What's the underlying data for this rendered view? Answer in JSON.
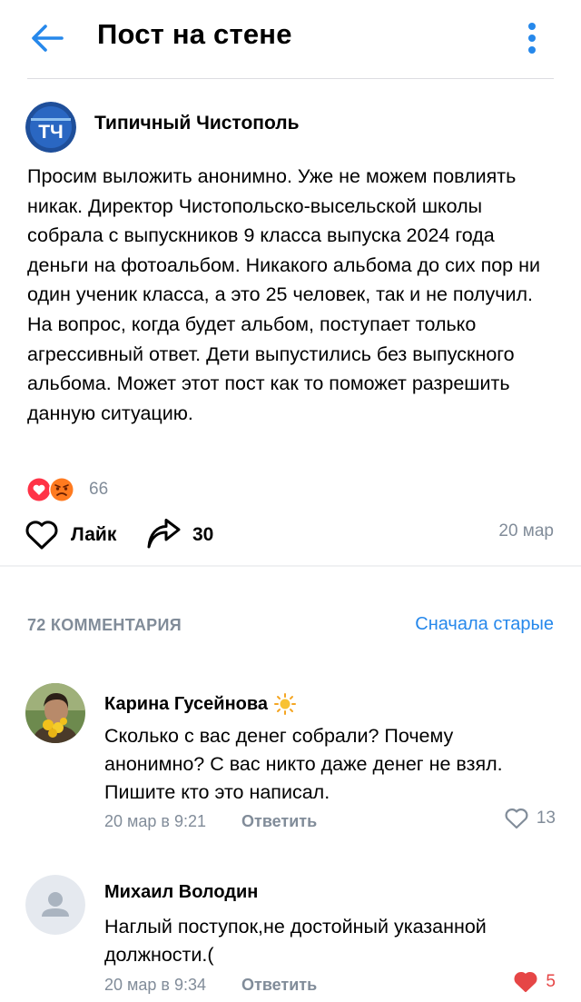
{
  "header": {
    "title": "Пост на стене"
  },
  "post": {
    "author": "Типичный Чистополь",
    "avatar_text": "ТЧ",
    "text": "Просим выложить анонимно. Уже не можем повлиять никак. Директор Чистопольско-высельской школы собрала с выпускников 9 класса выпуска 2024 года деньги на фотоальбом. Никакого альбома до сих пор ни один ученик класса, а это 25 человек, так и не получил. На вопрос, когда будет альбом, поступает только агрессивный ответ. Дети выпустились без выпускного альбома. Может этот пост как то поможет разрешить данную ситуацию.",
    "reactions_count": "66",
    "like_label": "Лайк",
    "share_count": "30",
    "date": "20 мар"
  },
  "comments_section": {
    "count_label": "72 КОММЕНТАРИЯ",
    "sort_label": "Сначала старые"
  },
  "comments": [
    {
      "author": "Карина Гусейнова",
      "text": "Сколько с вас денег собрали?  Почему анонимно? С вас никто даже денег не взял. Пишите кто это написал.",
      "date": "20 мар в 9:21",
      "reply_label": "Ответить",
      "likes": "13",
      "liked": false
    },
    {
      "author": "Михаил Володин",
      "text": "Наглый поступок,не достойный указанной должности.(",
      "date": "20 мар в 9:34",
      "reply_label": "Ответить",
      "likes": "5",
      "liked": true
    }
  ],
  "colors": {
    "accent": "#2688eb",
    "secondary_text": "#818c99",
    "like_red": "#e64646"
  },
  "icons": {
    "back": "arrow-left-icon",
    "more": "vertical-dots-icon",
    "like": "heart-icon",
    "share": "share-arrow-icon",
    "reaction_heart": "red-heart-reaction-icon",
    "reaction_angry": "angry-face-reaction-icon",
    "sun": "sun-emoji-icon",
    "placeholder_avatar": "user-placeholder-icon"
  }
}
